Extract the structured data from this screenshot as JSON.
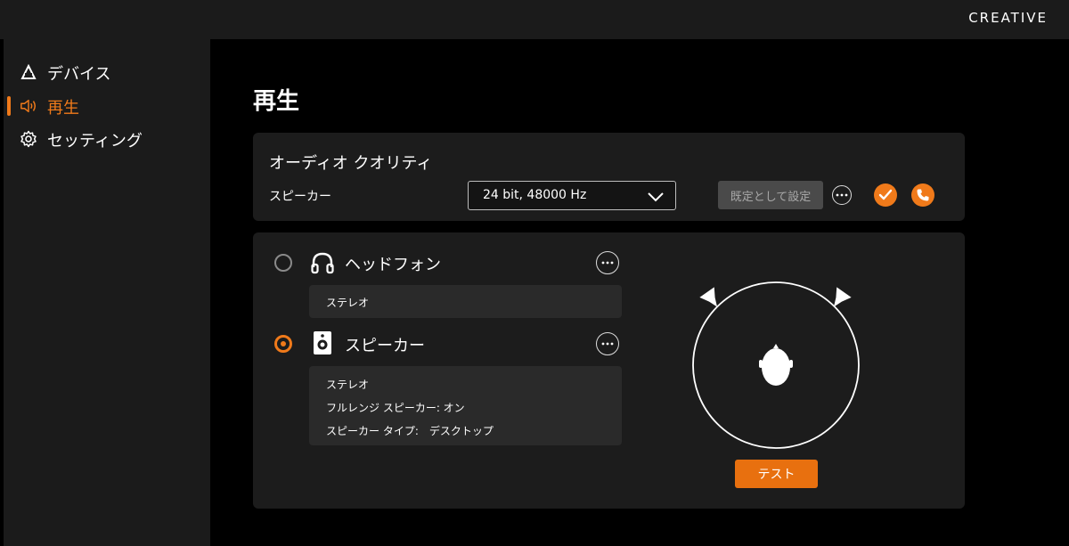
{
  "brand": {
    "name": "CREATIVE"
  },
  "sidebar": {
    "items": [
      {
        "label": "デバイス",
        "icon": "device-icon",
        "active": false
      },
      {
        "label": "再生",
        "icon": "speaker-volume-icon",
        "active": true
      },
      {
        "label": "セッティング",
        "icon": "gear-icon",
        "active": false
      }
    ]
  },
  "page": {
    "title": "再生"
  },
  "audio_quality": {
    "title": "オーディオ クオリティ",
    "device_label": "スピーカー",
    "format_value": "24 bit, 48000 Hz",
    "default_button_label": "既定として設定"
  },
  "outputs": [
    {
      "name": "ヘッドフォン",
      "icon": "headphones-icon",
      "selected": false,
      "details": [
        "ステレオ"
      ]
    },
    {
      "name": "スピーカー",
      "icon": "speaker-icon",
      "selected": true,
      "details": [
        "ステレオ",
        "フルレンジ スピーカー: オン",
        "スピーカー タイプ:　デスクトップ"
      ]
    }
  ],
  "test_button_label": "テスト",
  "colors": {
    "accent": "#f07a1a",
    "panel": "#1c1c1c",
    "sidebar": "#1b1b1b",
    "background": "#000000"
  }
}
